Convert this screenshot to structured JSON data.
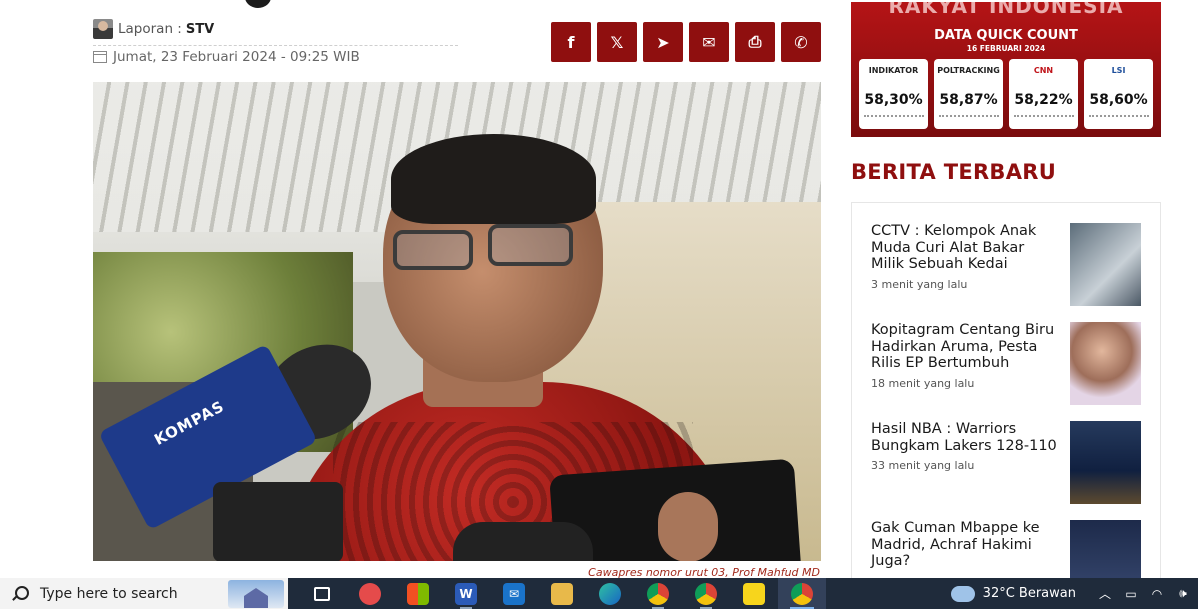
{
  "article": {
    "reporter_label": "Laporan :",
    "reporter_name": "STV",
    "date": "Jumat, 23 Februari 2024 - 09:25 WIB",
    "caption": "Cawapres nomor urut 03, Prof Mahfud MD"
  },
  "share": {
    "buttons": [
      {
        "name": "facebook",
        "glyph": "f"
      },
      {
        "name": "x",
        "glyph": "𝕏"
      },
      {
        "name": "telegram",
        "glyph": "➤"
      },
      {
        "name": "email",
        "glyph": "✉"
      },
      {
        "name": "print",
        "glyph": "⎙"
      },
      {
        "name": "whatsapp",
        "glyph": "✆"
      }
    ]
  },
  "photo": {
    "mic_label": "KOMPAS"
  },
  "banner": {
    "title": "RAKYAT INDONESIA",
    "subtitle": "DATA QUICK COUNT",
    "date": "16 FEBRUARI 2024",
    "cards": [
      {
        "logo": "INDIKATOR",
        "value": "58,30%"
      },
      {
        "logo": "POLTRACKING",
        "value": "58,87%"
      },
      {
        "logo": "CNN",
        "value": "58,22%"
      },
      {
        "logo": "LSI",
        "value": "58,60%"
      }
    ]
  },
  "latest": {
    "title": "BERITA TERBARU",
    "items": [
      {
        "title": "CCTV : Kelompok Anak Muda Curi Alat Bakar Milik Sebuah Kedai",
        "time": "3 menit yang lalu"
      },
      {
        "title": "Kopitagram Centang Biru Hadirkan Aruma, Pesta Rilis EP Bertumbuh",
        "time": "18 menit yang lalu"
      },
      {
        "title": "Hasil NBA : Warriors Bungkam Lakers 128-110",
        "time": "33 menit yang lalu"
      },
      {
        "title": "Gak Cuman Mbappe ke Madrid, Achraf Hakimi Juga?",
        "time": ""
      }
    ]
  },
  "taskbar": {
    "search_placeholder": "Type here to search",
    "weather": "32°C  Berawan",
    "colors": {
      "bg": "#1f2b3b",
      "accent": "#8f0f0f"
    }
  }
}
